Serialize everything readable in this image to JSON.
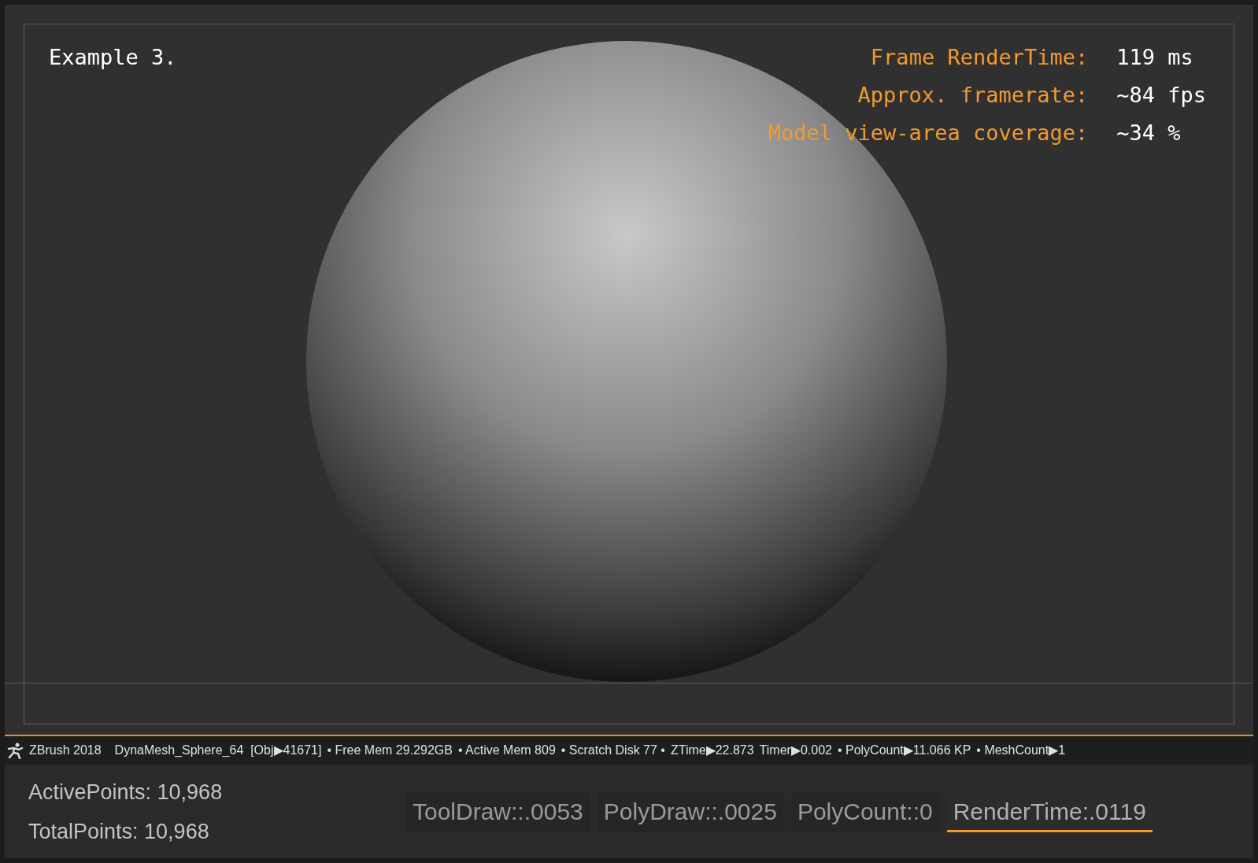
{
  "viewport": {
    "caption": "Example 3.",
    "stats": [
      {
        "label": "Frame RenderTime:",
        "value": "119 ms"
      },
      {
        "label": "Approx. framerate:",
        "value": "~84 fps"
      },
      {
        "label": "Model view-area coverage:",
        "value": "~34 %"
      }
    ]
  },
  "status_bar": {
    "items": [
      "ZBrush 2018",
      "DynaMesh_Sphere_64  [Obj▶41671]",
      "• Free Mem 29.292GB",
      "• Active Mem 809",
      "• Scratch Disk 77 •",
      "ZTime▶22.873",
      "Timer▶0.002",
      "• PolyCount▶11.066 KP",
      "• MeshCount▶1"
    ]
  },
  "points": [
    "ActivePoints: 10,968",
    "TotalPoints: 10,968"
  ],
  "metrics": [
    {
      "label": "ToolDraw::.0053",
      "selected": false
    },
    {
      "label": "PolyDraw::.0025",
      "selected": false
    },
    {
      "label": "PolyCount::0",
      "selected": false
    },
    {
      "label": "RenderTime:.0119",
      "selected": true
    }
  ]
}
